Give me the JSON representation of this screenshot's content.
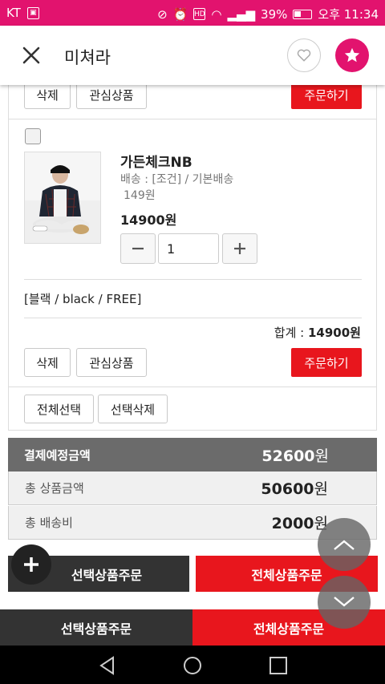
{
  "status": {
    "carrier": "KT",
    "battery": "39%",
    "time": "오후 11:34"
  },
  "header": {
    "title": "미쳐라"
  },
  "top_actions": {
    "delete": "삭제",
    "wishlist": "관심상품",
    "order": "주문하기"
  },
  "item": {
    "name": "가든체크NB",
    "shipping": "배송 : [조건] / 기본배송",
    "shipping_fee": "149원",
    "price": "14900원",
    "quantity": "1",
    "option": "[블랙 / black / FREE]",
    "total_label": "합계 : ",
    "total_value": "14900원",
    "delete": "삭제",
    "wishlist": "관심상품",
    "order": "주문하기"
  },
  "list_actions": {
    "select_all": "전체선택",
    "delete_selected": "선택삭제"
  },
  "summary": {
    "expected_label": "결제예정금액",
    "expected_value": "52600",
    "expected_unit": "원",
    "products_label": "총 상품금액",
    "products_value": "50600",
    "products_unit": "원",
    "shipping_label": "총 배송비",
    "shipping_value": "2000",
    "shipping_unit": "원"
  },
  "order_buttons": {
    "selected": "선택상품주문",
    "all": "전체상품주문"
  },
  "bottom_bar": {
    "selected": "선택상품주문",
    "all": "전체상품주문"
  },
  "colors": {
    "accent": "#e2136e",
    "red": "#e8161d",
    "dark": "#333333"
  }
}
